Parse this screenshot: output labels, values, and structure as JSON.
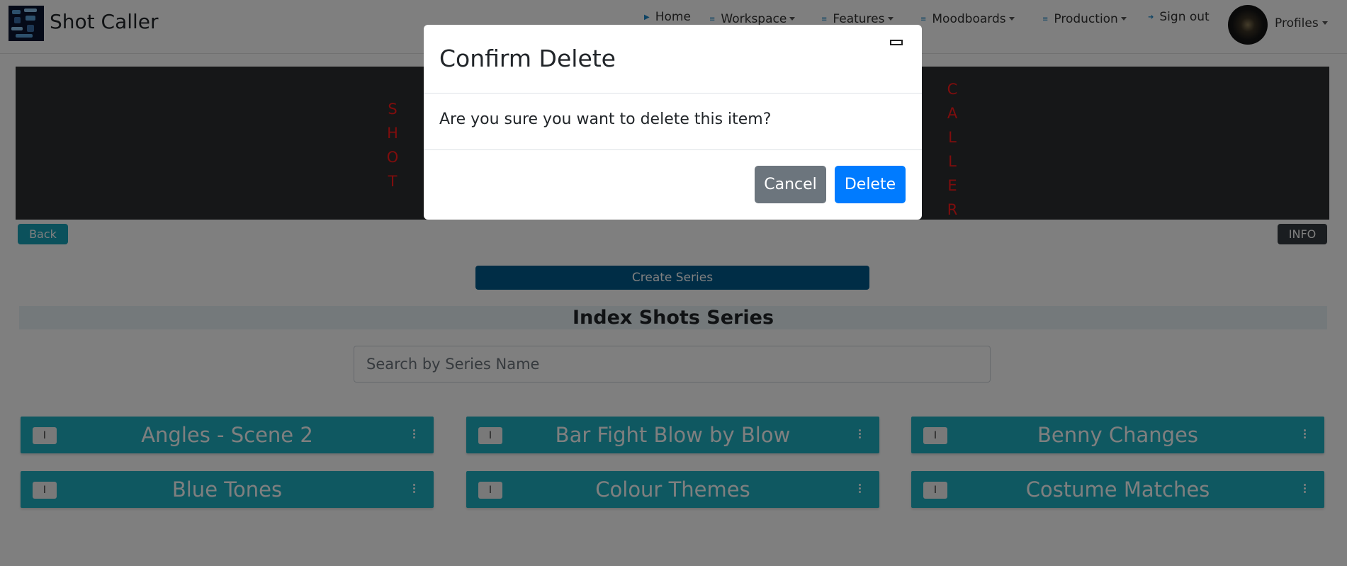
{
  "navbar": {
    "brand": "Shot Caller",
    "items": [
      {
        "label": "Home",
        "icon": "play-icon",
        "dropdown": false
      },
      {
        "label": "Workspace",
        "icon": "list-icon",
        "dropdown": true
      },
      {
        "label": "Features",
        "icon": "list-icon",
        "dropdown": true
      },
      {
        "label": "Moodboards",
        "icon": "list-icon",
        "dropdown": true
      },
      {
        "label": "Production",
        "icon": "list-icon",
        "dropdown": true
      },
      {
        "label": "Sign out",
        "icon": "signout-icon",
        "dropdown": false
      }
    ],
    "profiles_label": "Profiles"
  },
  "banner": {
    "left_word": [
      "S",
      "H",
      "O",
      "T"
    ],
    "right_word": [
      "C",
      "A",
      "L",
      "L",
      "E",
      "R"
    ],
    "letter_color": "#ff1a1a"
  },
  "page": {
    "back_label": "Back",
    "info_label": "INFO",
    "create_label": "Create Series",
    "section_title": "Index Shots Series",
    "search_placeholder": "Search by Series Name",
    "series": [
      {
        "name": "Angles - Scene 2",
        "select_label": "I"
      },
      {
        "name": "Bar Fight Blow by Blow",
        "select_label": "I"
      },
      {
        "name": "Benny Changes",
        "select_label": "I"
      },
      {
        "name": "Blue Tones",
        "select_label": "I"
      },
      {
        "name": "Colour Themes",
        "select_label": "I"
      },
      {
        "name": "Costume Matches",
        "select_label": "I"
      }
    ]
  },
  "modal": {
    "title": "Confirm Delete",
    "body": "Are you sure you want to delete this item?",
    "cancel_label": "Cancel",
    "delete_label": "Delete"
  },
  "colors": {
    "accent": "#17a2b8",
    "series_card": "#1fb1c3",
    "create_button": "#005b8d",
    "delete_button": "#007bff",
    "cancel_button": "#6c757d"
  }
}
